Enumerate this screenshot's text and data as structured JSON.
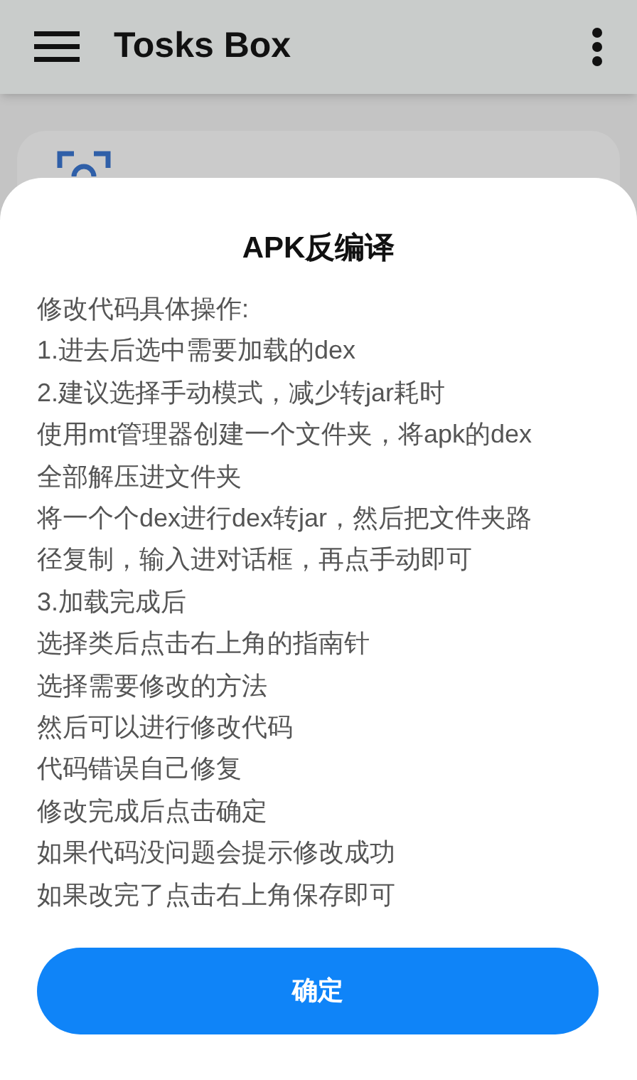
{
  "app_bar": {
    "title": "Tosks Box"
  },
  "dialog": {
    "title": "APK反编译",
    "lines": [
      "修改代码具体操作:",
      "1.进去后选中需要加载的dex",
      "2.建议选择手动模式，减少转jar耗时",
      "使用mt管理器创建一个文件夹，将apk的dex",
      "全部解压进文件夹",
      "将一个个dex进行dex转jar，然后把文件夹路",
      "径复制，输入进对话框，再点手动即可",
      "3.加载完成后",
      "选择类后点击右上角的指南针",
      "选择需要修改的方法",
      "然后可以进行修改代码",
      "代码错误自己修复",
      "修改完成后点击确定",
      "如果代码没问题会提示修改成功",
      "如果改完了点击右上角保存即可"
    ],
    "button": "确定"
  }
}
